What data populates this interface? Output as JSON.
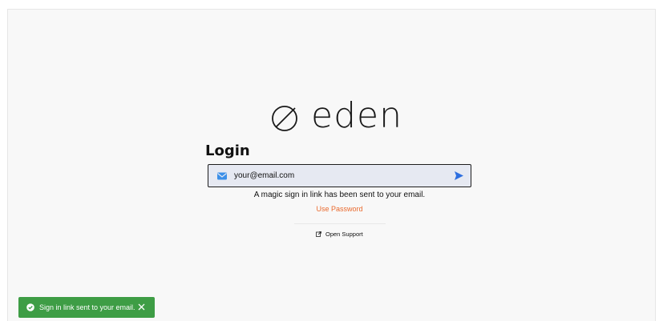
{
  "brand": {
    "name": "eden"
  },
  "login": {
    "title": "Login",
    "email_value": "your@email.com",
    "sent_message": "A magic sign in link has been sent to your email.",
    "use_password_label": "Use Password",
    "support_label": "Open Support"
  },
  "toast": {
    "message": "Sign in link sent to your email."
  },
  "colors": {
    "accent": "#ea6a2e",
    "send": "#2e6fe0",
    "toast": "#3e9d45",
    "mail_icon": "#3b8fe8"
  },
  "icons": {
    "logo": "eden-circle-slash-icon",
    "mail": "mail-icon",
    "send": "send-arrow-icon",
    "external": "external-link-icon",
    "check": "check-circle-icon",
    "close": "close-icon"
  }
}
